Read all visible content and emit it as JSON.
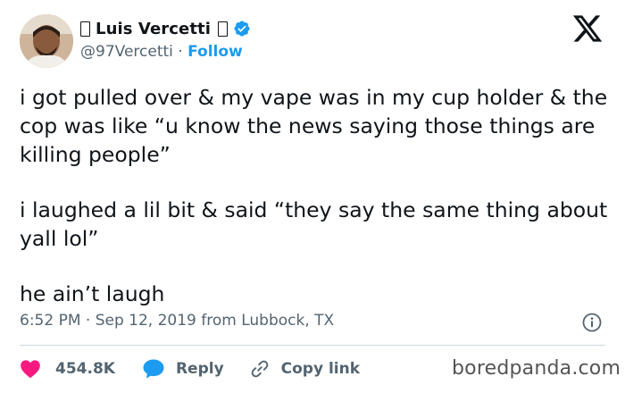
{
  "author": {
    "display_name": "Luis Vercetti",
    "handle": "@97Vercetti",
    "separator": "·",
    "follow_label": "Follow"
  },
  "tweet": {
    "paragraphs": [
      "i got pulled over & my vape was in my cup holder & the cop was like “u know the news saying those things are killing people”",
      "i laughed a lil bit & said “they say the same thing about yall lol”",
      "he ain’t laugh"
    ],
    "timestamp": "6:52 PM · Sep 12, 2019 from Lubbock, TX"
  },
  "actions": {
    "likes": "454.8K",
    "reply_label": "Reply",
    "copy_link_label": "Copy link"
  },
  "watermark": "boredpanda.com",
  "colors": {
    "accent": "#1d9bf0",
    "like": "#f91880",
    "text": "#0f1419",
    "secondary": "#536471"
  },
  "icons": [
    "x-logo-icon",
    "verified-badge-icon",
    "info-icon",
    "heart-icon",
    "reply-icon",
    "link-icon"
  ]
}
